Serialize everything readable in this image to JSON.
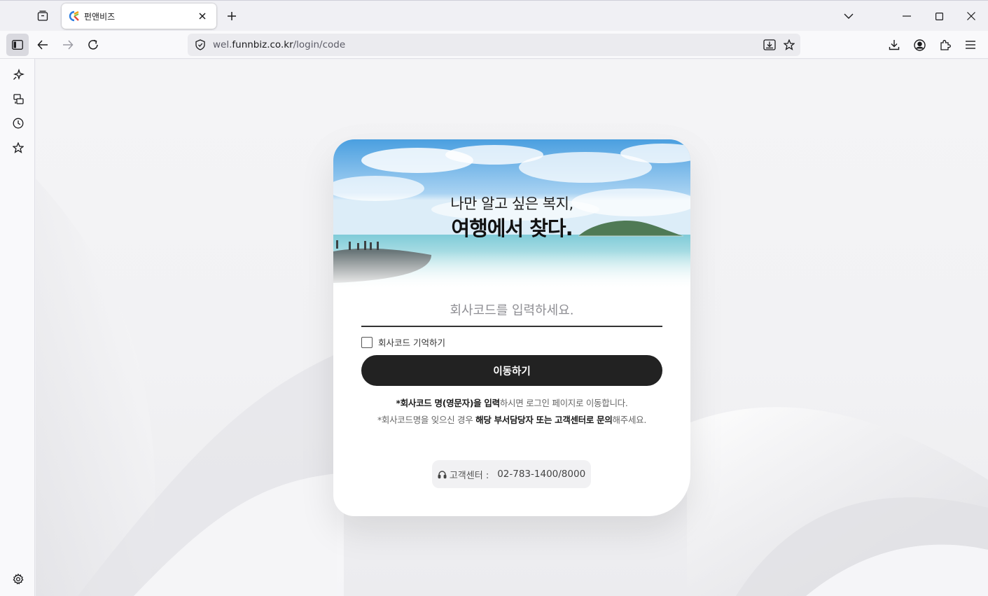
{
  "browser": {
    "tab": {
      "title": "펀앤비즈"
    },
    "url": {
      "prefix": "wel.",
      "host": "funnbiz.co.kr",
      "path": "/login/code"
    },
    "icons": {
      "tab_list": "tab-list-icon",
      "favicon": "funnbiz-favicon",
      "close_tab": "close-icon",
      "new_tab": "plus-icon",
      "tab_overflow": "chevron-down-icon",
      "minimize": "minimize-icon",
      "maximize": "maximize-icon",
      "close_window": "close-icon",
      "sidebar_toggle": "sidebar-icon",
      "back": "arrow-left-icon",
      "forward": "arrow-right-icon",
      "reload": "reload-icon",
      "site_info": "shield-icon",
      "reader_save": "save-page-icon",
      "bookmark": "star-icon",
      "downloads": "download-icon",
      "account": "account-icon",
      "extensions": "puzzle-icon",
      "menu": "hamburger-icon"
    },
    "sidebar": {
      "items": [
        {
          "icon": "ai-sparkle-icon"
        },
        {
          "icon": "synced-tabs-icon"
        },
        {
          "icon": "history-icon"
        },
        {
          "icon": "bookmarks-star-icon"
        }
      ],
      "settings_icon": "gear-icon"
    }
  },
  "page": {
    "hero": {
      "line1": "나만 알고 싶은 복지,",
      "line2": "여행에서 찾다."
    },
    "company_code": {
      "placeholder": "회사코드를 입력하세요.",
      "value": ""
    },
    "remember": {
      "label": "회사코드 기억하기",
      "checked": false
    },
    "submit_label": "이동하기",
    "notes": {
      "line1_bold": "*회사코드 명(영문자)을 입력",
      "line1_rest": "하시면 로그인 페이지로 이동합니다.",
      "line2_pre": "*회사코드명을 잊으신 경우 ",
      "line2_bold": "해당 부서담당자 또는 고객센터",
      "line2_mid": "로 문의",
      "line2_post": "해주세요."
    },
    "support": {
      "label": "고객센터 :",
      "number": "02-783-1400/8000",
      "icon": "headset-icon"
    }
  },
  "colors": {
    "button": "#222222",
    "accent_brand": "#e8483b"
  }
}
